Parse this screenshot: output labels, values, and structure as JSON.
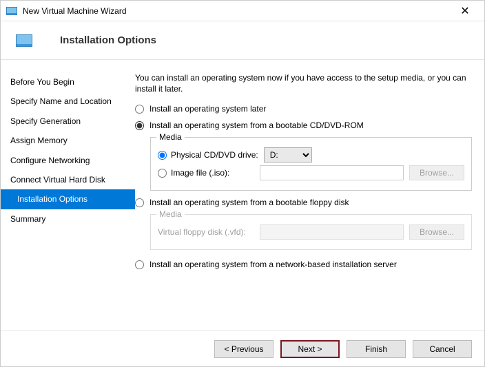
{
  "titlebar": {
    "title": "New Virtual Machine Wizard"
  },
  "header": {
    "title": "Installation Options"
  },
  "nav": {
    "items": [
      {
        "label": "Before You Begin"
      },
      {
        "label": "Specify Name and Location"
      },
      {
        "label": "Specify Generation"
      },
      {
        "label": "Assign Memory"
      },
      {
        "label": "Configure Networking"
      },
      {
        "label": "Connect Virtual Hard Disk"
      },
      {
        "label": "Installation Options"
      },
      {
        "label": "Summary"
      }
    ]
  },
  "content": {
    "description": "You can install an operating system now if you have access to the setup media, or you can install it later.",
    "opt_later": "Install an operating system later",
    "opt_cd": "Install an operating system from a bootable CD/DVD-ROM",
    "opt_floppy": "Install an operating system from a bootable floppy disk",
    "opt_net": "Install an operating system from a network-based installation server",
    "media_legend": "Media",
    "physical_label": "Physical CD/DVD drive:",
    "drive_value": "D:",
    "image_label": "Image file (.iso):",
    "browse": "Browse...",
    "vfd_label": "Virtual floppy disk (.vfd):"
  },
  "footer": {
    "previous": "< Previous",
    "next": "Next >",
    "finish": "Finish",
    "cancel": "Cancel"
  }
}
